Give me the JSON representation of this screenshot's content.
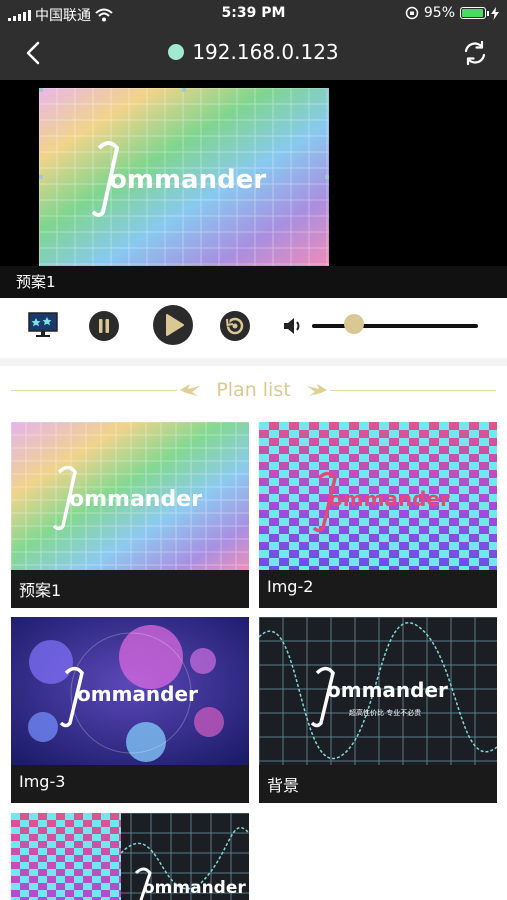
{
  "status_bar": {
    "carrier": "中国联通",
    "time": "5:39 PM",
    "battery_percent": "95%",
    "battery_level": 0.95
  },
  "nav": {
    "title": "192.168.0.123",
    "status_color": "#a3e8d0"
  },
  "preview": {
    "label": "预案1",
    "logo_text": "ommander"
  },
  "controls": {
    "volume_level": 0.25
  },
  "plan_list": {
    "title": "Plan list",
    "items": [
      {
        "label": "预案1",
        "logo_text": "ommander"
      },
      {
        "label": "Img-2",
        "logo_text": "ommander"
      },
      {
        "label": "Img-3",
        "logo_text": "ommander"
      },
      {
        "label": "背景",
        "logo_text": "ommander",
        "subtitle": "超高性价比 专业不必贵"
      },
      {
        "label": "",
        "logo_text": "ommander"
      }
    ]
  },
  "colors": {
    "accent": "#dcc98e",
    "header_bg": "#2f2f2f",
    "control_btn": "#2b2b2b"
  }
}
